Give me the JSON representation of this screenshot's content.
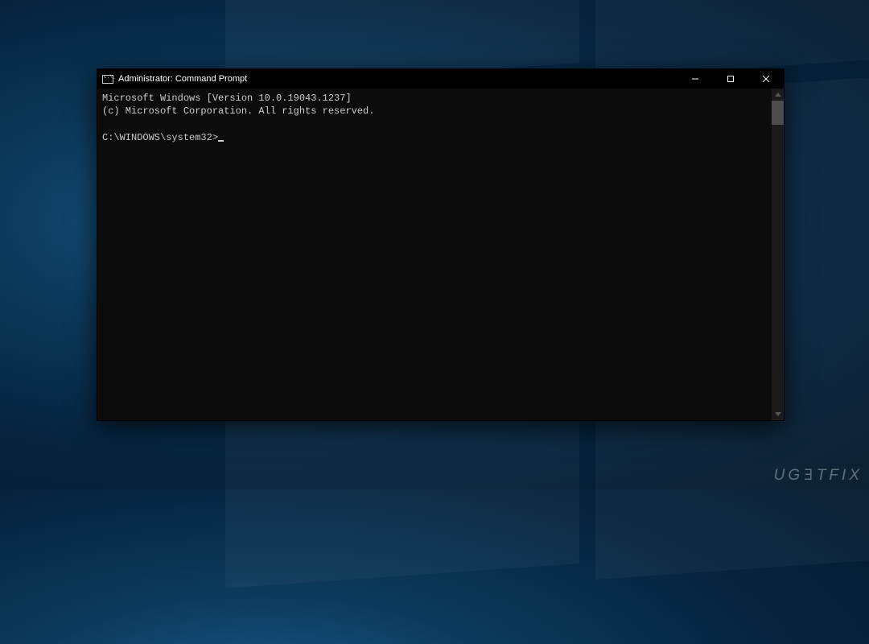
{
  "window": {
    "title": "Administrator: Command Prompt"
  },
  "terminal": {
    "line1": "Microsoft Windows [Version 10.0.19043.1237]",
    "line2": "(c) Microsoft Corporation. All rights reserved.",
    "prompt": "C:\\WINDOWS\\system32>"
  },
  "watermark": {
    "text_pre": "UG",
    "text_e": "Ǝ",
    "text_post": "TFIX"
  }
}
